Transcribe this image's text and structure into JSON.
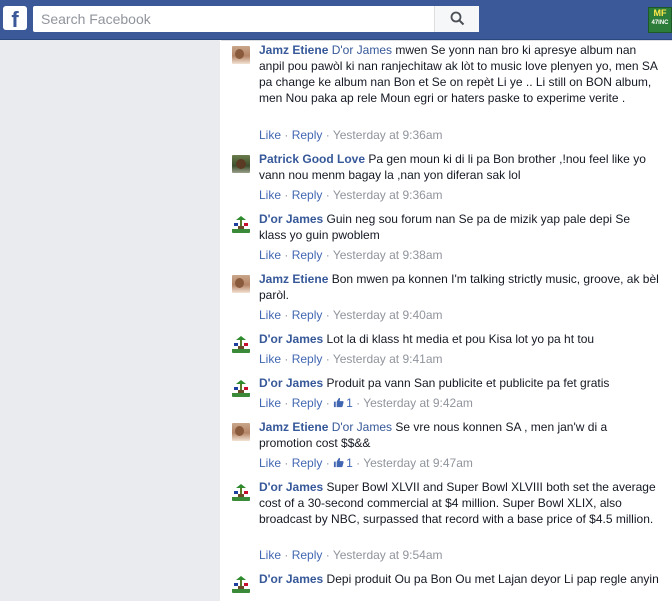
{
  "header": {
    "logo": "f",
    "search_placeholder": "Search Facebook",
    "app_badge_top": "MF",
    "app_badge_bottom": "47INC"
  },
  "actions": {
    "like": "Like",
    "reply": "Reply",
    "separator": "·"
  },
  "comments": [
    {
      "author": "Jamz Etiene",
      "mention": "D'or James",
      "text": " mwen Se yonn nan bro ki apresye album nan anpil pou pawòl ki nan ranjechitaw ak lòt to music love plenyen yo, men SA pa change ke album nan Bon et Se on repèt Li ye .. Li still on BON album, men Nou paka ap rele Moun egri or haters paske to experime verite .",
      "time": "Yesterday at 9:36am",
      "likes": ""
    },
    {
      "author": "Patrick Good Love",
      "mention": "",
      "text": " Pa gen moun ki di li pa Bon brother ,!nou feel like yo vann nou menm bagay la ,nan yon diferan sak lol",
      "time": "Yesterday at 9:36am",
      "likes": ""
    },
    {
      "author": "D'or James",
      "mention": "",
      "text": " Guin neg sou forum nan Se pa de mizik yap pale depi Se klass yo guin pwoblem",
      "time": "Yesterday at 9:38am",
      "likes": ""
    },
    {
      "author": "Jamz Etiene",
      "mention": "",
      "text": " Bon mwen pa konnen I'm talking strictly music, groove, ak bèl paròl.",
      "time": "Yesterday at 9:40am",
      "likes": ""
    },
    {
      "author": "D'or James",
      "mention": "",
      "text": " Lot la di klass ht media et pou Kisa lot yo pa ht tou",
      "time": "Yesterday at 9:41am",
      "likes": ""
    },
    {
      "author": "D'or James",
      "mention": "",
      "text": " Produit pa vann San publicite et publicite pa fet gratis",
      "time": "Yesterday at 9:42am",
      "likes": "1"
    },
    {
      "author": "Jamz Etiene",
      "mention": "D'or James",
      "text": " Se vre nous konnen SA , men jan'w di a promotion cost $$&&",
      "time": "Yesterday at 9:47am",
      "likes": "1"
    },
    {
      "author": "D'or James",
      "mention": "",
      "text": " Super Bowl XLVII and Super Bowl XLVIII both set the average cost of a 30-second commercial at $4 million. Super Bowl XLIX, also broadcast by NBC, surpassed that record with a base price of $4.5 million.",
      "time": "Yesterday at 9:54am",
      "likes": ""
    },
    {
      "author": "D'or James",
      "mention": "",
      "text": " Depi produit Ou pa Bon Ou met Lajan deyor Li pap regle anyin",
      "time": "",
      "likes": ""
    }
  ],
  "colors": {
    "topbar": "#3b5998",
    "link": "#365899",
    "meta": "#90949c",
    "sidebar_bg": "#e9ebee"
  }
}
